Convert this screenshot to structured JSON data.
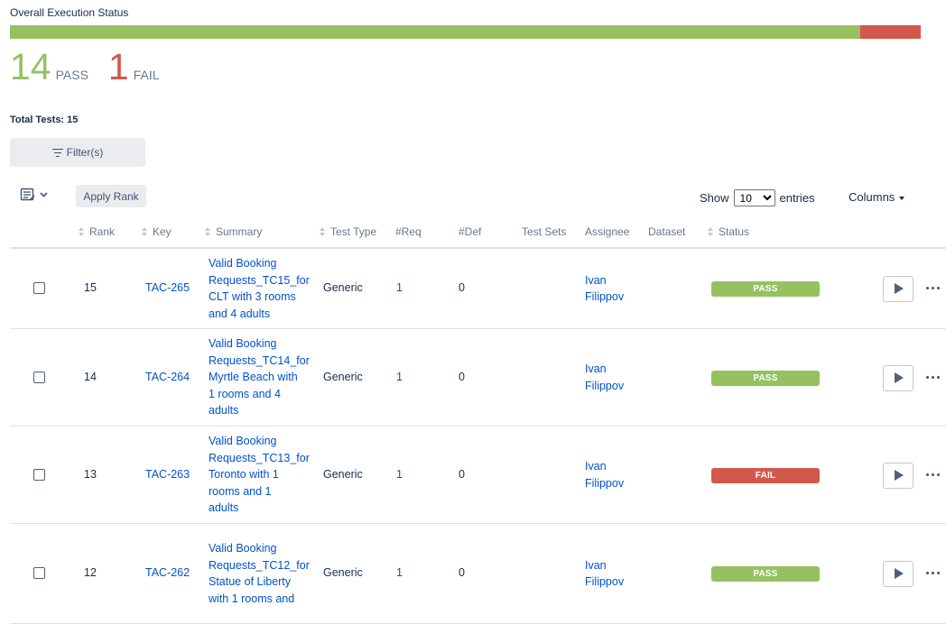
{
  "status_title": "Overall Execution Status",
  "progress": {
    "pass_fraction": 0.9333,
    "fail_fraction": 0.0667
  },
  "counts": {
    "pass_number": "14",
    "pass_label": "PASS",
    "fail_number": "1",
    "fail_label": "FAIL"
  },
  "total_label": "Total Tests: 15",
  "toolbar": {
    "filter_label": "Filter(s)",
    "apply_rank_label": "Apply Rank",
    "show_label": "Show",
    "show_value": "10",
    "entries_label": "entries",
    "columns_label": "Columns"
  },
  "columns": [
    "Rank",
    "Key",
    "Summary",
    "Test Type",
    "#Req",
    "#Def",
    "Test Sets",
    "Assignee",
    "Dataset",
    "Status"
  ],
  "rows": [
    {
      "rank": "15",
      "key": "TAC-265",
      "summary": [
        "Valid Booking",
        "Requests_TC15_for",
        "CLT with 3 rooms",
        "and 4 adults"
      ],
      "type": "Generic",
      "req": "1",
      "def": "0",
      "assignee": [
        "Ivan",
        "Filippov"
      ],
      "status": "PASS"
    },
    {
      "rank": "14",
      "key": "TAC-264",
      "summary": [
        "Valid Booking",
        "Requests_TC14_for",
        "Myrtle Beach with",
        "1 rooms and 4",
        "adults"
      ],
      "type": "Generic",
      "req": "1",
      "def": "0",
      "assignee": [
        "Ivan",
        "Filippov"
      ],
      "status": "PASS"
    },
    {
      "rank": "13",
      "key": "TAC-263",
      "summary": [
        "Valid Booking",
        "Requests_TC13_for",
        "Toronto with 1",
        "rooms and 1",
        "adults"
      ],
      "type": "Generic",
      "req": "1",
      "def": "0",
      "assignee": [
        "Ivan",
        "Filippov"
      ],
      "status": "FAIL"
    },
    {
      "rank": "12",
      "key": "TAC-262",
      "summary": [
        "Valid Booking",
        "Requests_TC12_for",
        "Statue of Liberty",
        "with 1 rooms and"
      ],
      "type": "Generic",
      "req": "1",
      "def": "0",
      "assignee": [
        "Ivan",
        "Filippov"
      ],
      "status": "PASS"
    }
  ],
  "colors": {
    "pass": "#95c160",
    "fail": "#d3584c",
    "link": "#0052cc"
  },
  "icons": {
    "filter": "filter-lines-icon",
    "view": "list-view-icon",
    "run": "play-icon",
    "more": "more-dots-icon"
  }
}
